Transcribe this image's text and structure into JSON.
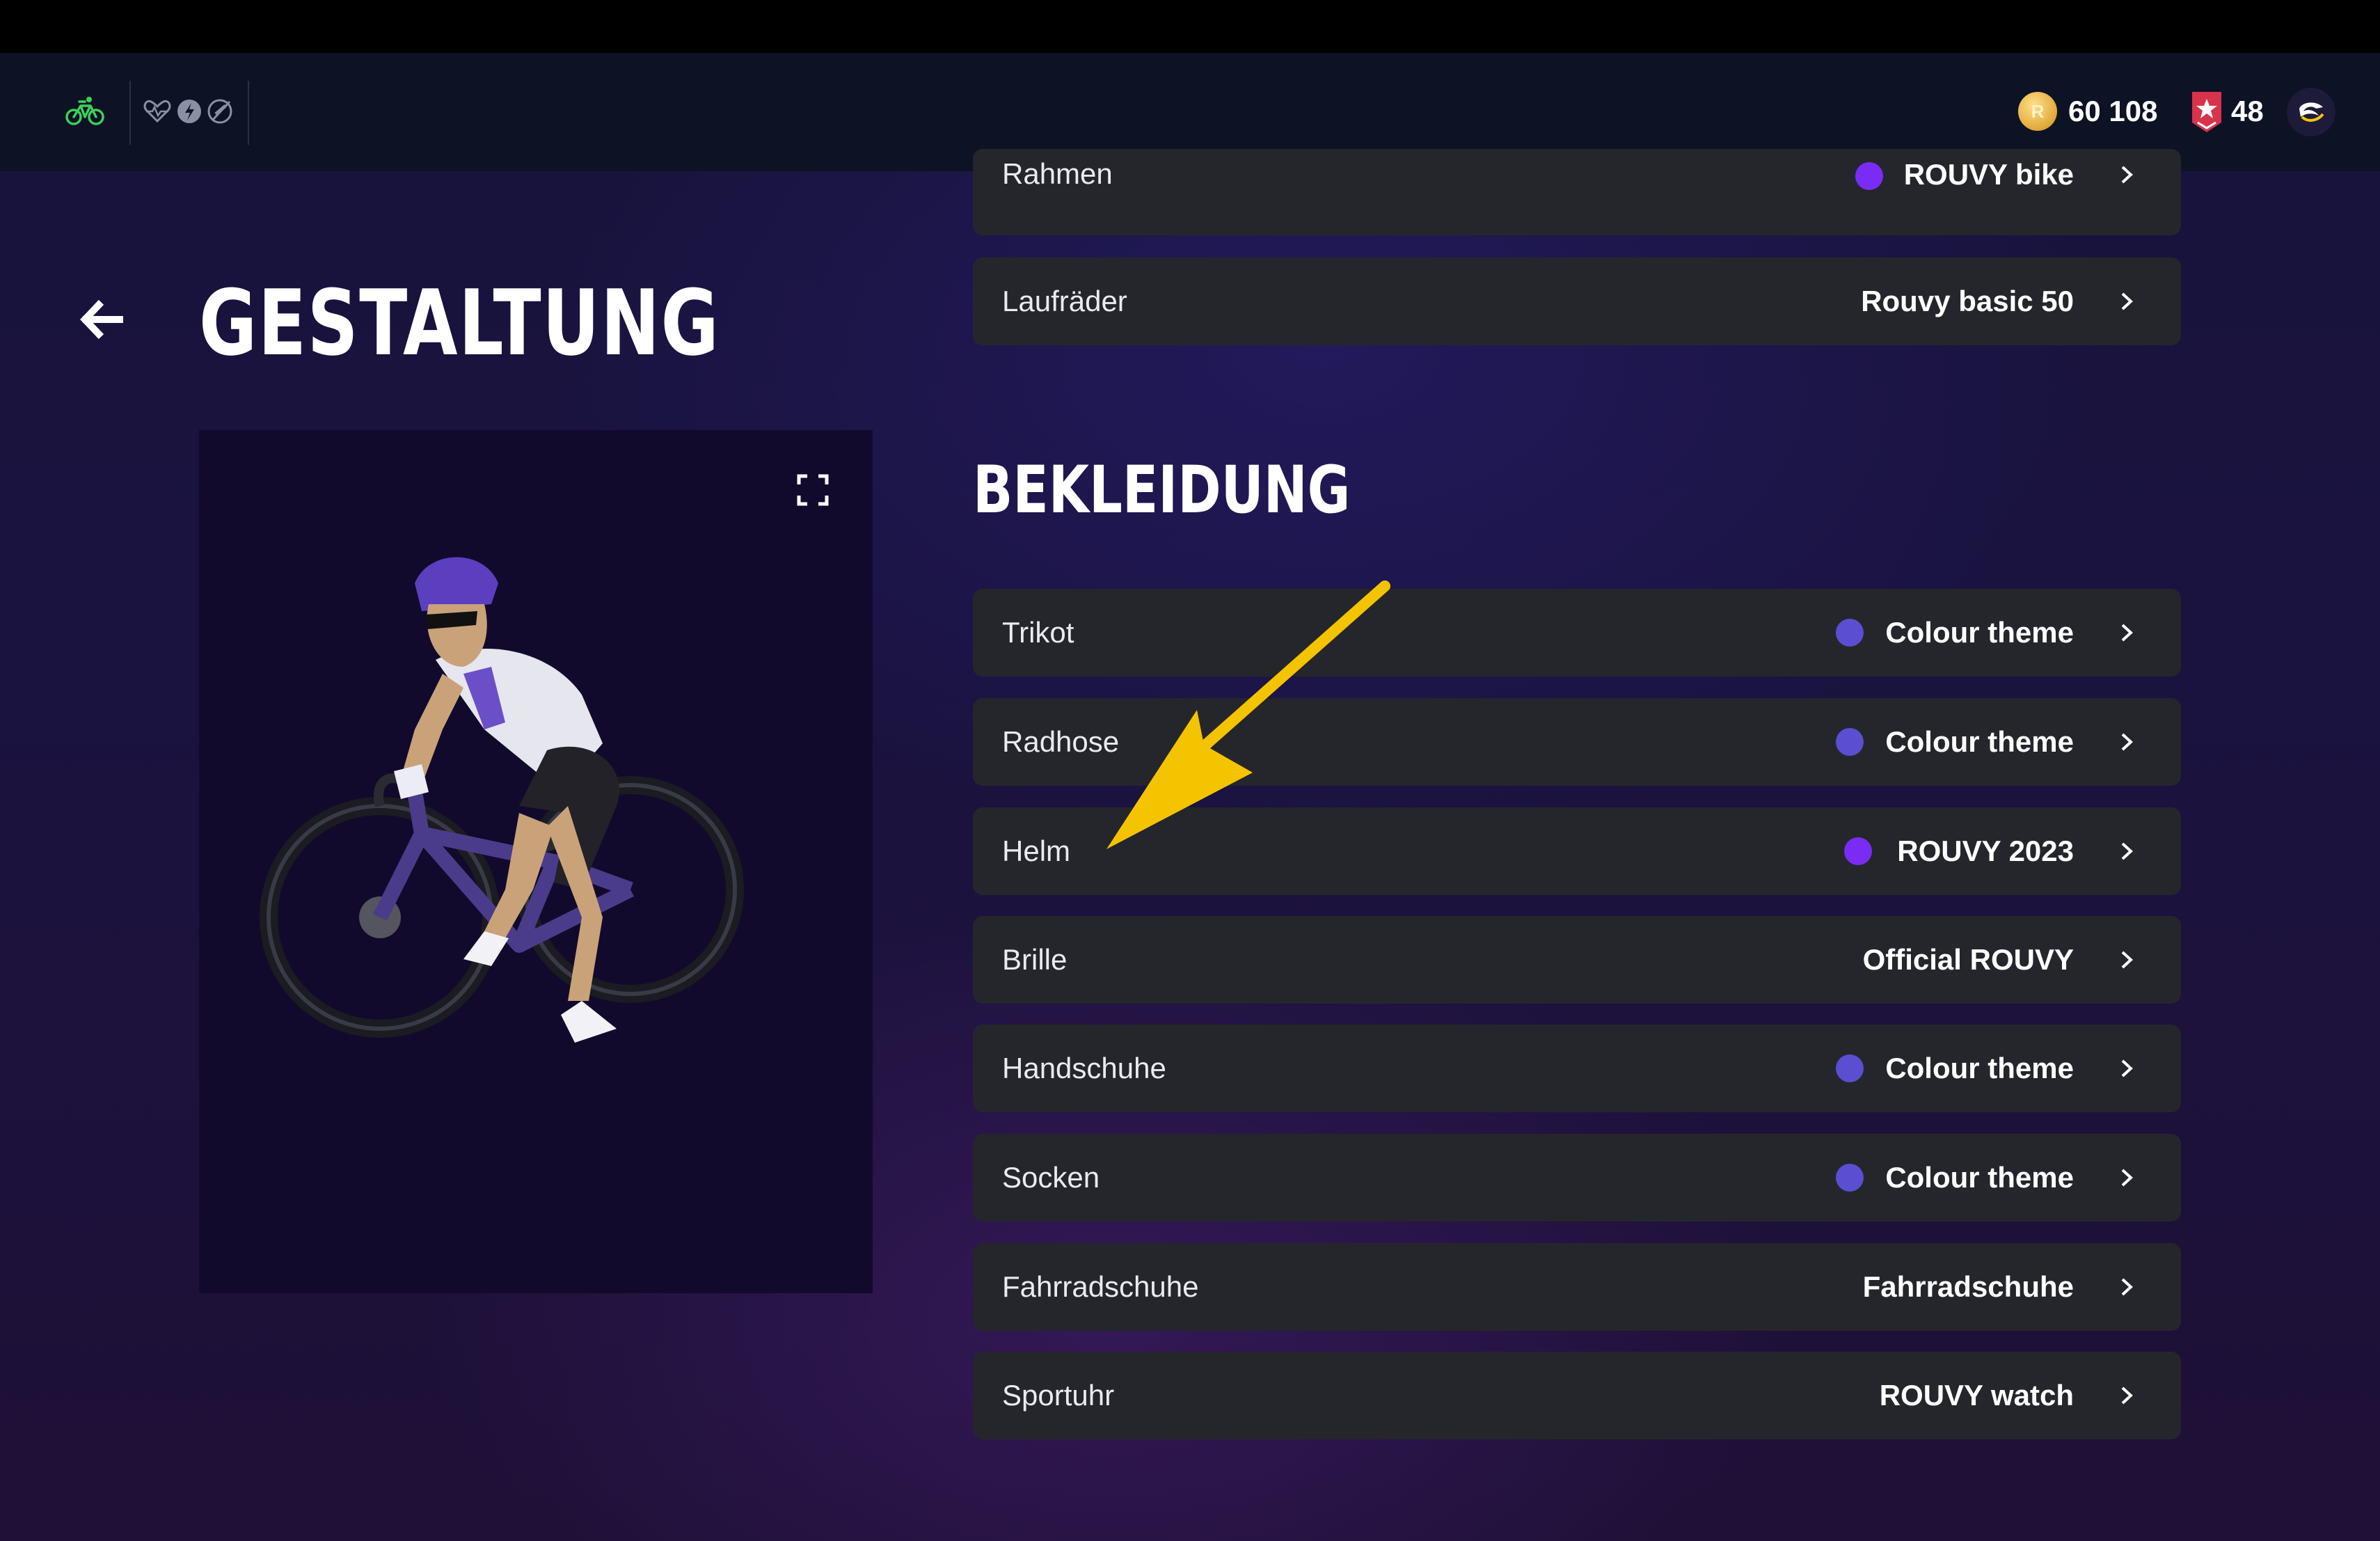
{
  "header": {
    "coins": "60 108",
    "rank": "48",
    "coin_symbol": "R"
  },
  "page": {
    "title": "GESTALTUNG"
  },
  "bike_section": {
    "rows": [
      {
        "label": "Rahmen",
        "value": "ROUVY bike",
        "dot_color": "#7a2cf5"
      },
      {
        "label": "Laufräder",
        "value": "Rouvy basic 50"
      }
    ]
  },
  "clothing_section": {
    "title": "BEKLEIDUNG",
    "rows": [
      {
        "label": "Trikot",
        "value": "Colour theme",
        "dot_color": "#5b4ed1"
      },
      {
        "label": "Radhose",
        "value": "Colour theme",
        "dot_color": "#5b4ed1"
      },
      {
        "label": "Helm",
        "value": "ROUVY 2023",
        "dot_color": "#7a2cf5"
      },
      {
        "label": "Brille",
        "value": "Official ROUVY"
      },
      {
        "label": "Handschuhe",
        "value": "Colour theme",
        "dot_color": "#5b4ed1"
      },
      {
        "label": "Socken",
        "value": "Colour theme",
        "dot_color": "#5b4ed1"
      },
      {
        "label": "Fahrradschuhe",
        "value": "Fahrradschuhe"
      },
      {
        "label": "Sportuhr",
        "value": "ROUVY watch"
      }
    ]
  },
  "colors": {
    "accent_green": "#3ecf5a",
    "annotation_arrow": "#f5c400",
    "row_bg": "#25262c"
  },
  "icons": [
    "bike-icon",
    "heart-rate-icon",
    "power-icon",
    "speed-sensor-icon",
    "coin-icon",
    "rank-badge-icon",
    "avatar-icon",
    "back-arrow-icon",
    "expand-icon",
    "chevron-right-icon"
  ]
}
